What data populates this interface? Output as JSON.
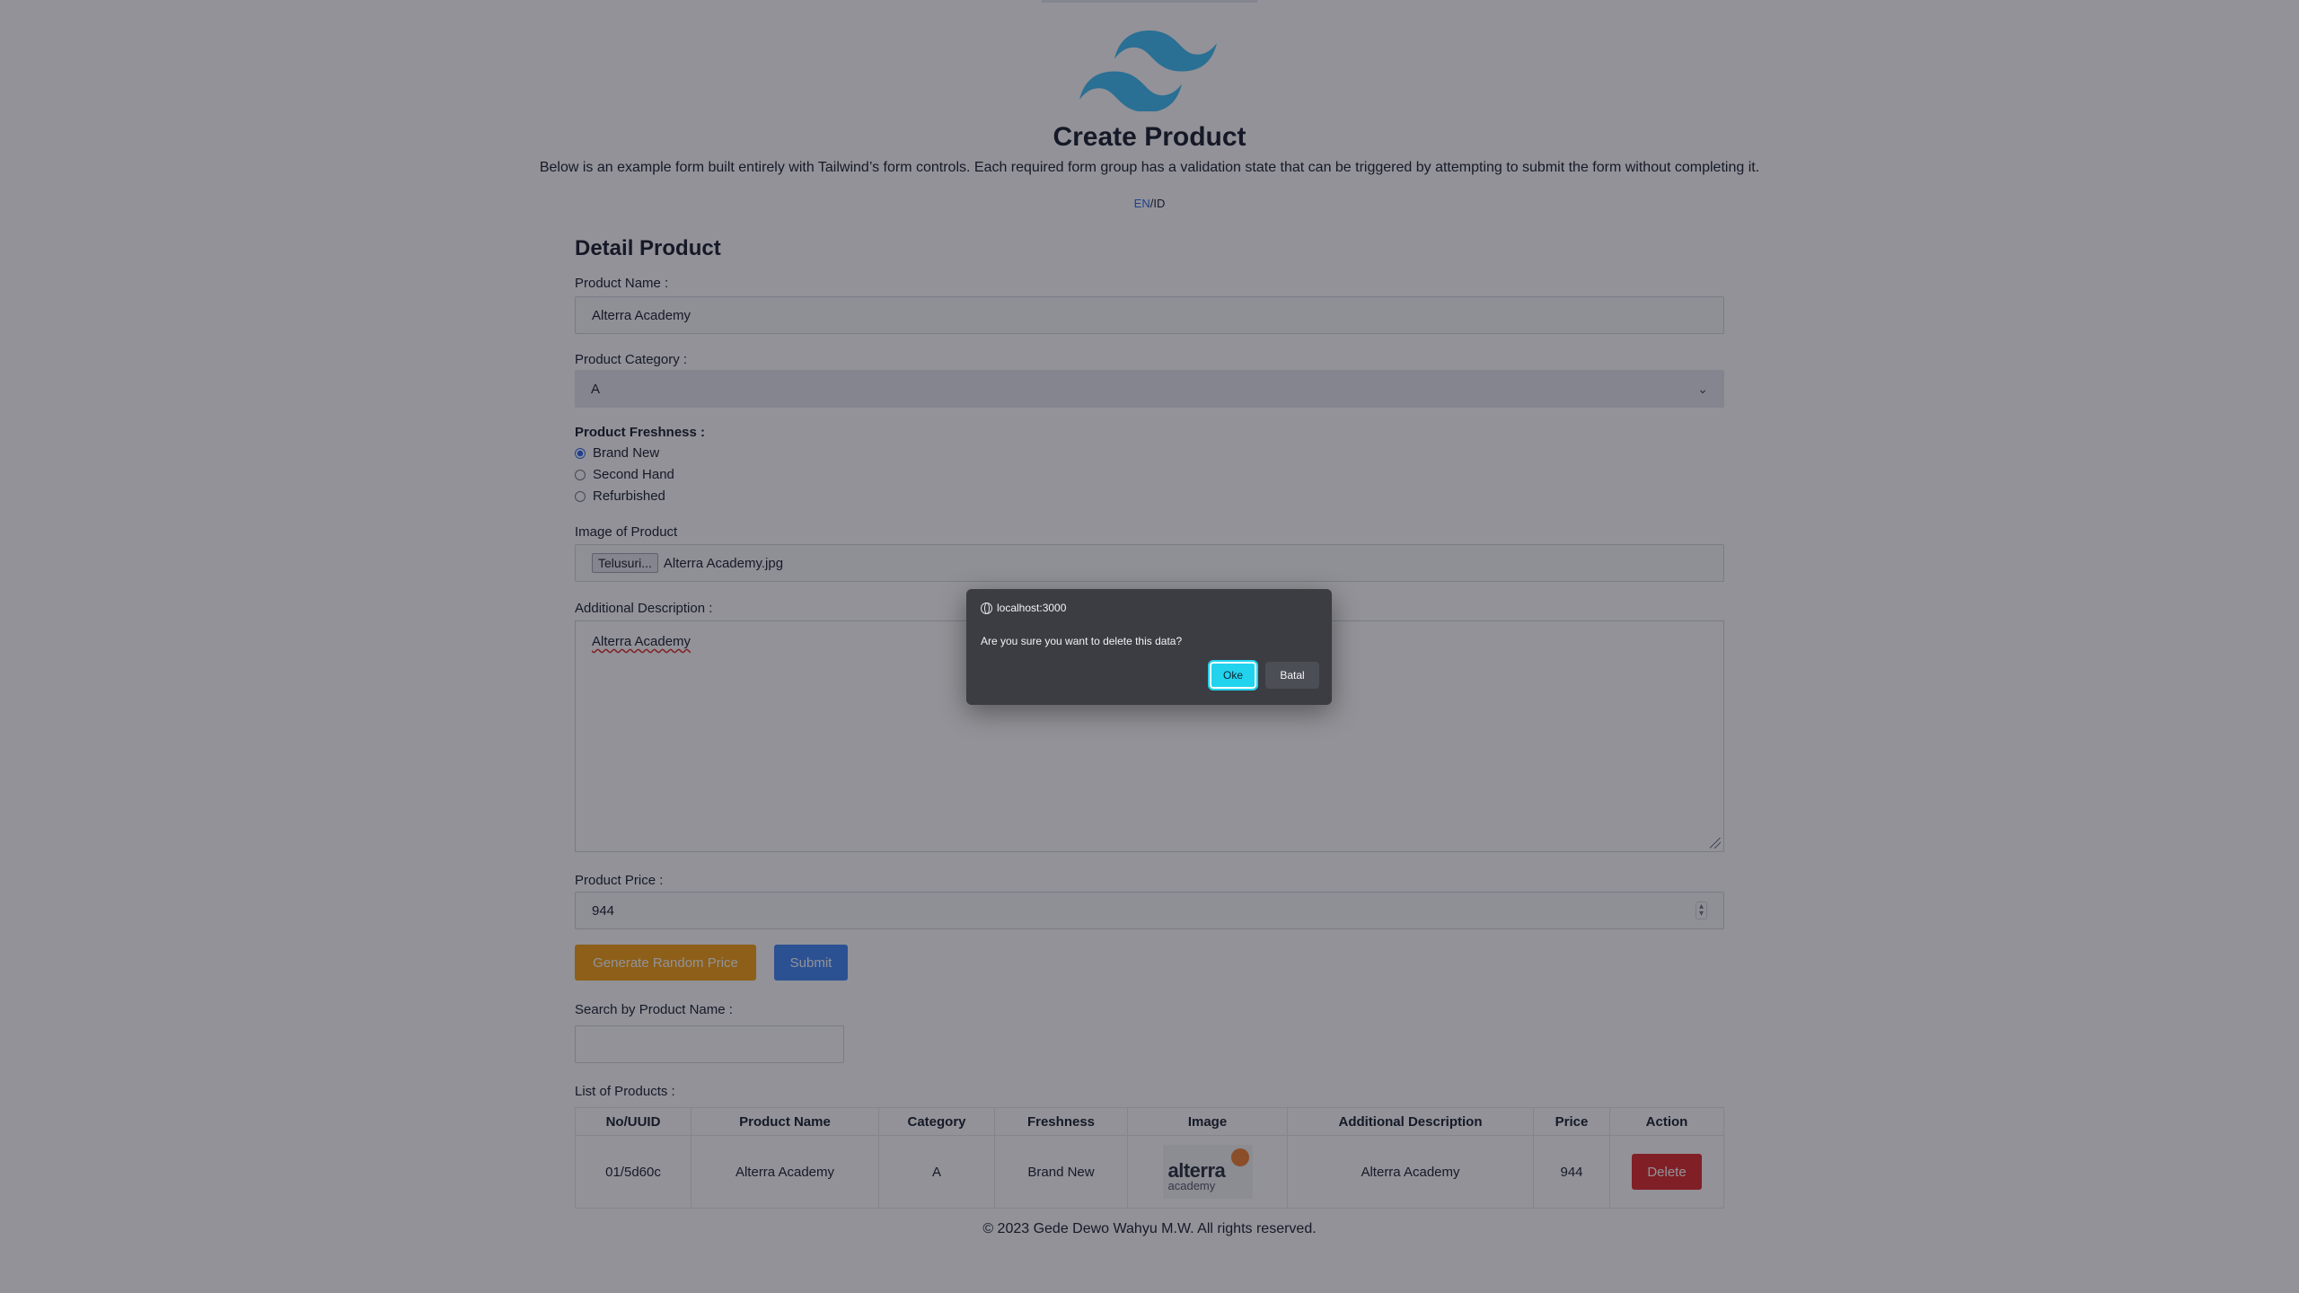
{
  "header": {
    "title": "Create Product",
    "subtitle": "Below is an example form built entirely with Tailwind’s form controls. Each required form group has a validation state that can be triggered by attempting to submit the form without completing it.",
    "lang_en": "EN",
    "lang_sep": "/",
    "lang_id": "ID",
    "logo_color": "#38bdf8"
  },
  "form": {
    "section_title": "Detail Product",
    "product_name_label": "Product Name :",
    "product_name_value": "Alterra Academy",
    "category_label": "Product Category :",
    "category_value": "A",
    "freshness_label": "Product Freshness :",
    "freshness_options": [
      "Brand New",
      "Second Hand",
      "Refurbished"
    ],
    "freshness_selected": "Brand New",
    "image_label": "Image of Product",
    "file_button": "Telusuri...",
    "file_name": "Alterra Academy.jpg",
    "description_label": "Additional Description :",
    "description_value": "Alterra Academy",
    "price_label": "Product Price :",
    "price_value": "944",
    "generate_button": "Generate Random Price",
    "submit_button": "Submit",
    "search_label": "Search by Product Name :",
    "search_value": ""
  },
  "table": {
    "caption": "List of Products :",
    "headers": [
      "No/UUID",
      "Product Name",
      "Category",
      "Freshness",
      "Image",
      "Additional Description",
      "Price",
      "Action"
    ],
    "rows": [
      {
        "uuid": "01/5d60c",
        "name": "Alterra Academy",
        "category": "A",
        "freshness": "Brand New",
        "image_brand": "alterra",
        "image_sub": "academy",
        "description": "Alterra Academy",
        "price": "944",
        "action": "Delete"
      }
    ]
  },
  "footer": {
    "text": "© 2023 Gede Dewo Wahyu M.W. All rights reserved."
  },
  "dialog": {
    "host": "localhost:3000",
    "message": "Are you sure you want to delete this data?",
    "ok_label": "Oke",
    "cancel_label": "Batal"
  },
  "colors": {
    "accent_blue": "#3b82f6",
    "accent_yellow": "#f59e0b",
    "danger_red": "#dc2626",
    "dialog_ok": "#22d3ee"
  }
}
